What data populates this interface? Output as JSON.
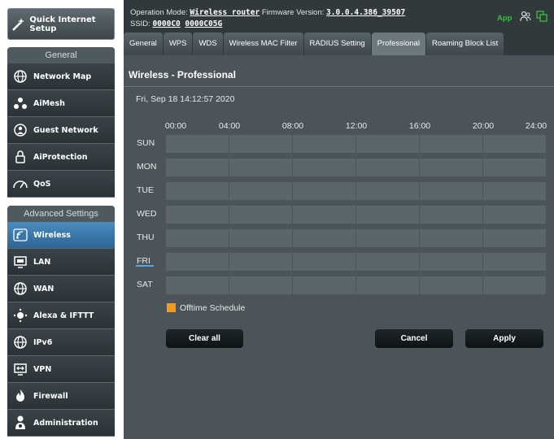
{
  "sidebar": {
    "quick_setup": "Quick Internet Setup",
    "general_header": "General",
    "general_items": [
      {
        "label": "Network Map",
        "icon": "globe-icon"
      },
      {
        "label": "AiMesh",
        "icon": "mesh-icon"
      },
      {
        "label": "Guest Network",
        "icon": "guest-network-icon"
      },
      {
        "label": "AiProtection",
        "icon": "lock-icon"
      },
      {
        "label": "QoS",
        "icon": "gauge-icon"
      }
    ],
    "advanced_header": "Advanced Settings",
    "advanced_items": [
      {
        "label": "Wireless",
        "icon": "wifi-icon",
        "active": true
      },
      {
        "label": "LAN",
        "icon": "monitor-icon"
      },
      {
        "label": "WAN",
        "icon": "globe-icon"
      },
      {
        "label": "Alexa & IFTTT",
        "icon": "voice-icon"
      },
      {
        "label": "IPv6",
        "icon": "globe-icon"
      },
      {
        "label": "VPN",
        "icon": "vpn-icon"
      },
      {
        "label": "Firewall",
        "icon": "fire-icon"
      },
      {
        "label": "Administration",
        "icon": "person-gear-icon"
      }
    ]
  },
  "header": {
    "op_mode_label": "Operation Mode:",
    "op_mode_value": "Wireless router",
    "fw_label": "Firmware Version:",
    "fw_value": "3.0.0.4.386_39507",
    "ssid_label": "SSID:",
    "ssid_1": "0000C0",
    "ssid_2": "0000C05G",
    "app_label": "App"
  },
  "tabs": [
    {
      "label": "General"
    },
    {
      "label": "WPS"
    },
    {
      "label": "WDS"
    },
    {
      "label": "Wireless MAC Filter"
    },
    {
      "label": "RADIUS Setting"
    },
    {
      "label": "Professional",
      "active": true
    },
    {
      "label": "Roaming Block List"
    }
  ],
  "main": {
    "title": "Wireless - Professional",
    "datetime": "Fri, Sep 18 14:12:57 2020",
    "hours": [
      "00:00",
      "04:00",
      "08:00",
      "12:00",
      "16:00",
      "20:00",
      "24:00"
    ],
    "days": [
      "SUN",
      "MON",
      "TUE",
      "WED",
      "THU",
      "FRI",
      "SAT"
    ],
    "today": "FRI",
    "legend": "Offtime Schedule",
    "offtime_color": "#f19a1d",
    "buttons": {
      "clear_all": "Clear all",
      "cancel": "Cancel",
      "apply": "Apply"
    }
  },
  "colors": {
    "active_menu": "#3b7bb0",
    "app_green": "#35c13a",
    "panel_bg": "#4b5559",
    "header_bg": "#32393c"
  }
}
